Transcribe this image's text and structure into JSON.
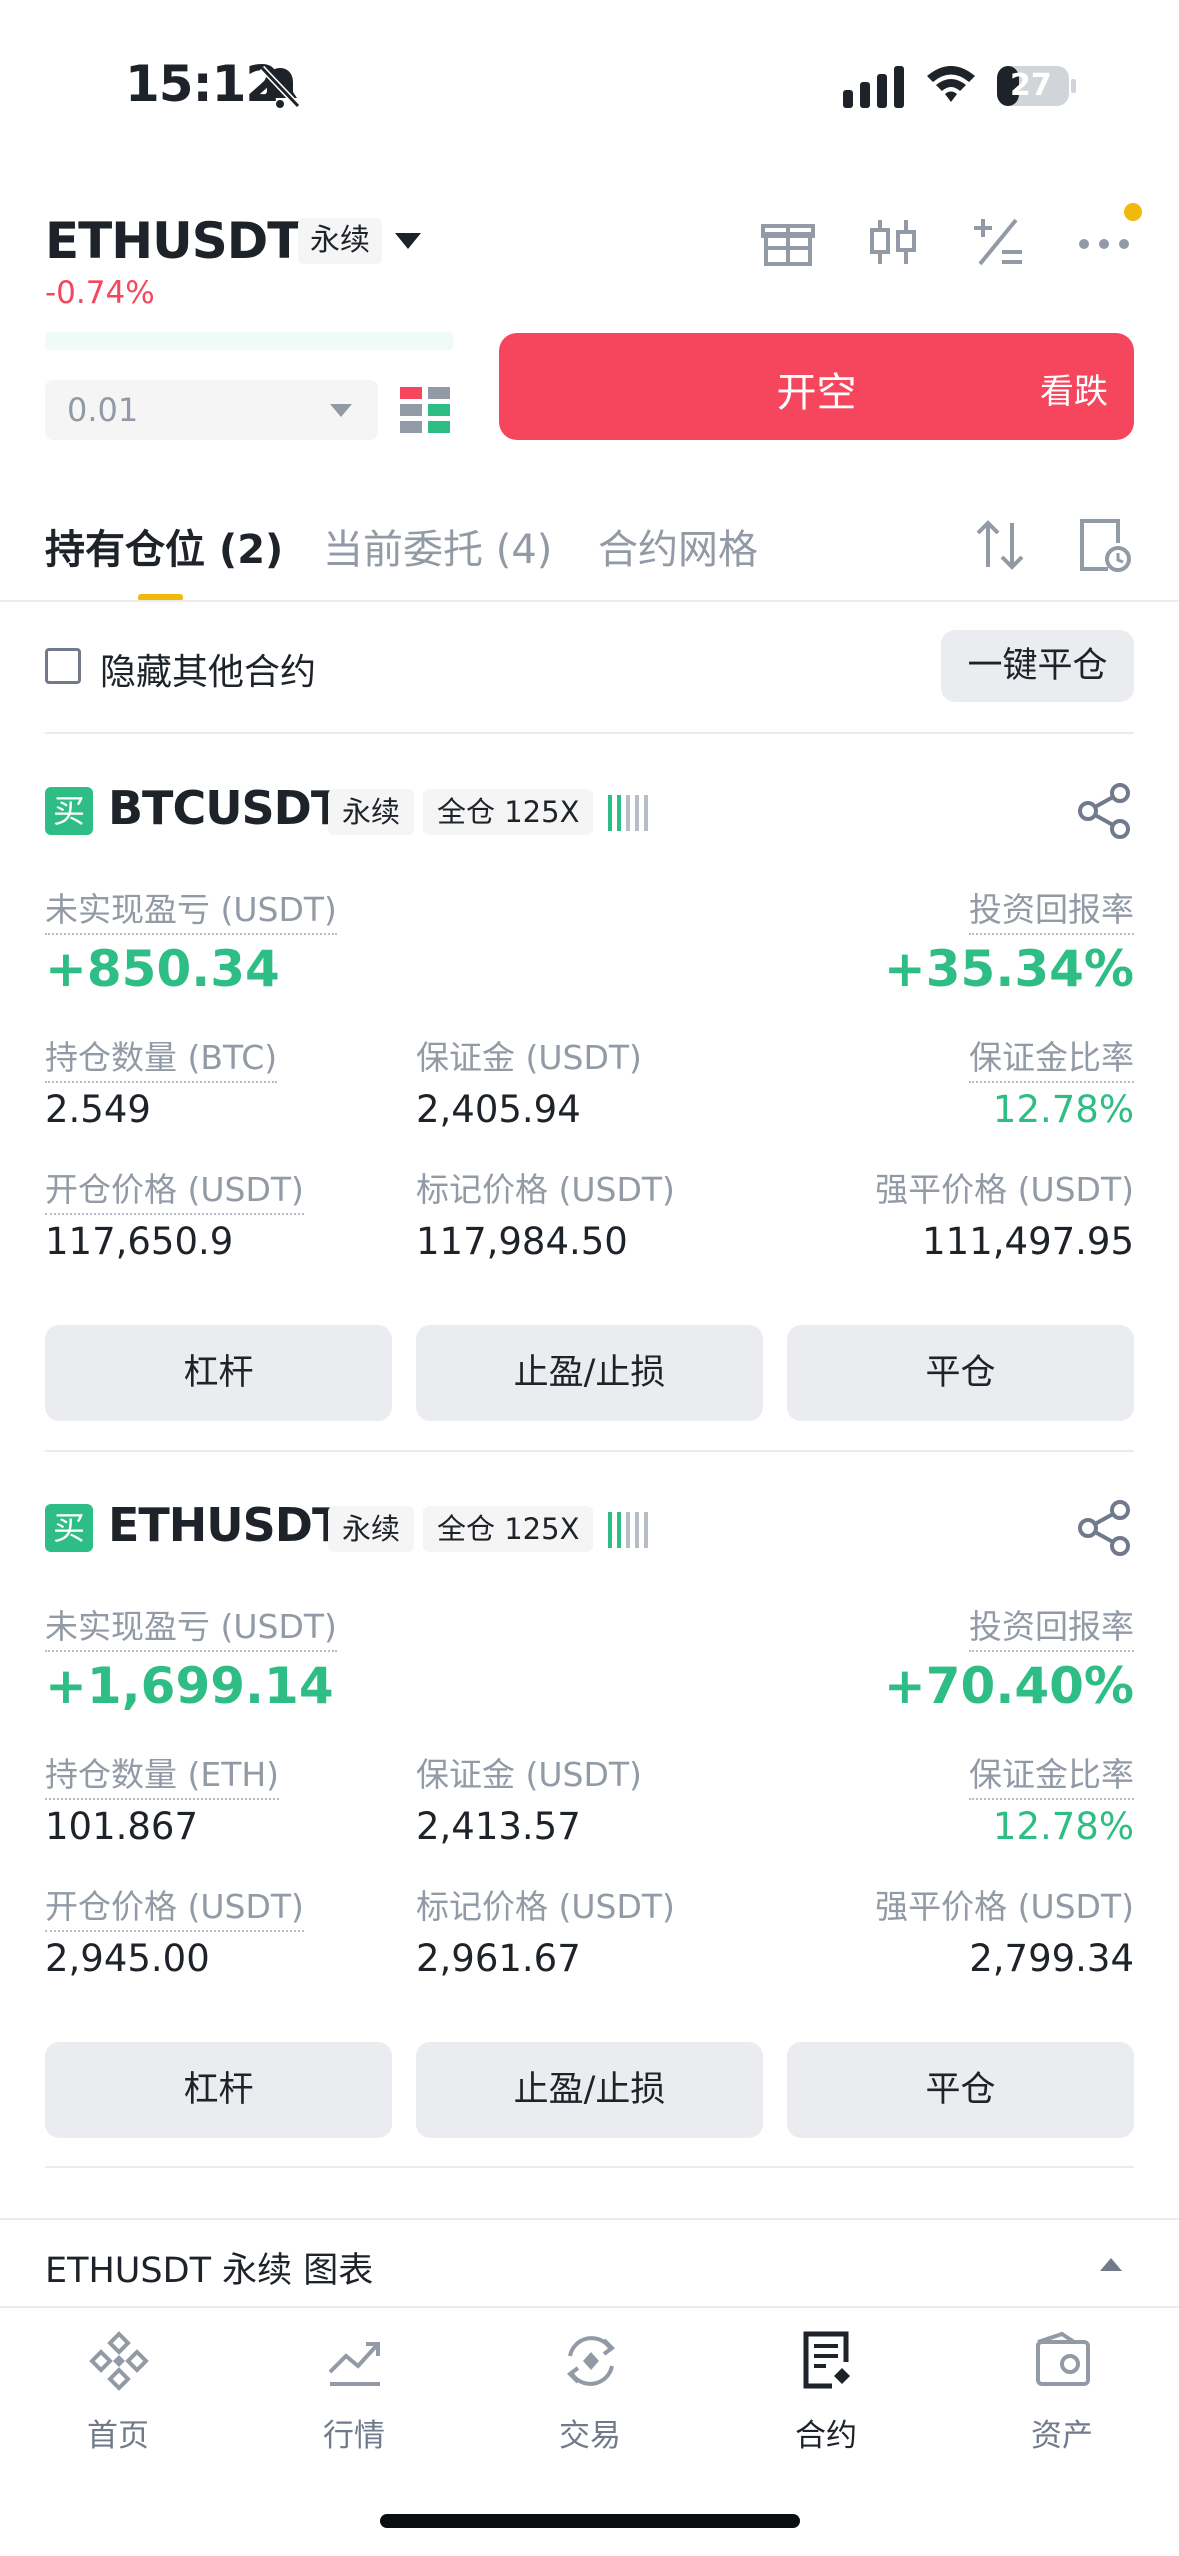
{
  "status_bar": {
    "time": "15:12",
    "battery": "27"
  },
  "header": {
    "symbol": "ETHUSDT",
    "type_tag": "永续",
    "change": "-0.74%",
    "icons": [
      "gift-icon",
      "candlestick-icon",
      "calculator-icon",
      "more-icon"
    ]
  },
  "order": {
    "quantity_value": "0.01",
    "open_short_label": "开空",
    "open_short_sub": "看跌"
  },
  "tabs": [
    {
      "label": "持有仓位 (2)",
      "active": true
    },
    {
      "label": "当前委托 (4)",
      "active": false
    },
    {
      "label": "合约网格",
      "active": false
    }
  ],
  "filter": {
    "hide_label": "隐藏其他合约",
    "close_all_label": "一键平仓"
  },
  "positions": [
    {
      "side": "买",
      "symbol": "BTCUSDT",
      "type_tag": "永续",
      "margin_tag": "全仓 125X",
      "pnl_label": "未实现盈亏 (USDT)",
      "pnl_value": "+850.34",
      "roi_label": "投资回报率",
      "roi_value": "+35.34%",
      "size_label": "持仓数量 (BTC)",
      "size_value": "2.549",
      "margin_label": "保证金 (USDT)",
      "margin_value": "2,405.94",
      "margin_ratio_label": "保证金比率",
      "margin_ratio_value": "12.78%",
      "entry_label": "开仓价格 (USDT)",
      "entry_value": "117,650.9",
      "mark_label": "标记价格 (USDT)",
      "mark_value": "117,984.50",
      "liq_label": "强平价格 (USDT)",
      "liq_value": "111,497.95",
      "buttons": [
        "杠杆",
        "止盈/止损",
        "平仓"
      ]
    },
    {
      "side": "买",
      "symbol": "ETHUSDT",
      "type_tag": "永续",
      "margin_tag": "全仓 125X",
      "pnl_label": "未实现盈亏 (USDT)",
      "pnl_value": "+1,699.14",
      "roi_label": "投资回报率",
      "roi_value": "+70.40%",
      "size_label": "持仓数量 (ETH)",
      "size_value": "101.867",
      "margin_label": "保证金 (USDT)",
      "margin_value": "2,413.57",
      "margin_ratio_label": "保证金比率",
      "margin_ratio_value": "12.78%",
      "entry_label": "开仓价格 (USDT)",
      "entry_value": "2,945.00",
      "mark_label": "标记价格 (USDT)",
      "mark_value": "2,961.67",
      "liq_label": "强平价格 (USDT)",
      "liq_value": "2,799.34",
      "buttons": [
        "杠杆",
        "止盈/止损",
        "平仓"
      ]
    }
  ],
  "chart_bar": {
    "label": "ETHUSDT 永续  图表"
  },
  "nav": [
    {
      "label": "首页",
      "icon": "home-icon",
      "active": false
    },
    {
      "label": "行情",
      "icon": "markets-icon",
      "active": false
    },
    {
      "label": "交易",
      "icon": "trade-icon",
      "active": false
    },
    {
      "label": "合约",
      "icon": "futures-icon",
      "active": true
    },
    {
      "label": "资产",
      "icon": "wallet-icon",
      "active": false
    }
  ],
  "colors": {
    "red": "#f6465d",
    "green": "#2ebd85",
    "yellow": "#f0b90b"
  }
}
